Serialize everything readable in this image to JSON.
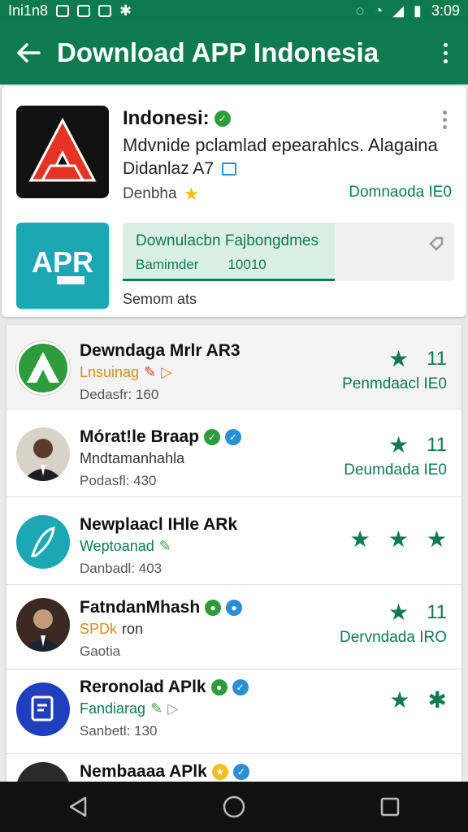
{
  "status_bar": {
    "carrier": "Ini1n8",
    "time": "3:09"
  },
  "app_bar": {
    "title": "Download APP Indonesia"
  },
  "featured": {
    "name": "Indonesi:",
    "description": "Mdvnide pclamlad epearahlcs. Alagaina",
    "description2": "Didanlaz A7",
    "developer": "Denbha",
    "downloads": "Domnaoda IE0",
    "download_box": {
      "title": "Downulacbn Fajbongdmes",
      "sub_left": "Bamimder",
      "sub_right": "10010",
      "progress": 0.64
    },
    "footer": "Semom ats"
  },
  "apps": [
    {
      "name": "Dewndaga Mrlr AR3",
      "subtitle": "Lnsuinag",
      "subtitle_color": "#e08a1e",
      "meta": "Dedasfr: 160",
      "rating": "11",
      "downloads": "Penmdaacl IE0",
      "icon": "green-a-logo-icon"
    },
    {
      "name": "Mórat!le Braap",
      "subtitle": "Mndtamanhahla",
      "subtitle_color": "#333333",
      "meta": "Podasfl: 430",
      "rating": "11",
      "downloads": "Deumdada IE0",
      "icon": "user-avatar"
    },
    {
      "name": "Newplaacl IHle ARk",
      "subtitle": "Weptoanad",
      "subtitle_color": "#0d7b4d",
      "meta": "Danbadl: 403",
      "rating": "",
      "downloads": "",
      "icon": "teal-feather-logo-icon"
    },
    {
      "name": "FatndanMhash",
      "subtitle": "SPDk",
      "subtitle_suffix": "ron",
      "subtitle_color": "#e08a1e",
      "meta": "Gaotia",
      "rating": "11",
      "downloads": "Dervndada IRO",
      "icon": "user-avatar"
    },
    {
      "name": "Reronolad APlk",
      "subtitle": "Fandiarag",
      "subtitle_color": "#0d7b4d",
      "meta": "Sanbetl: 130",
      "rating": "",
      "downloads": "",
      "icon": "blue-document-logo-icon"
    },
    {
      "name": "Nembaaaa APlk",
      "subtitle": "",
      "subtitle_color": "#333333",
      "meta": "",
      "rating": "",
      "downloads": "",
      "icon": "user-avatar"
    }
  ],
  "colors": {
    "primary": "#0d7b4d",
    "accent_orange": "#e08a1e",
    "verified_blue": "#2b8fd6"
  }
}
